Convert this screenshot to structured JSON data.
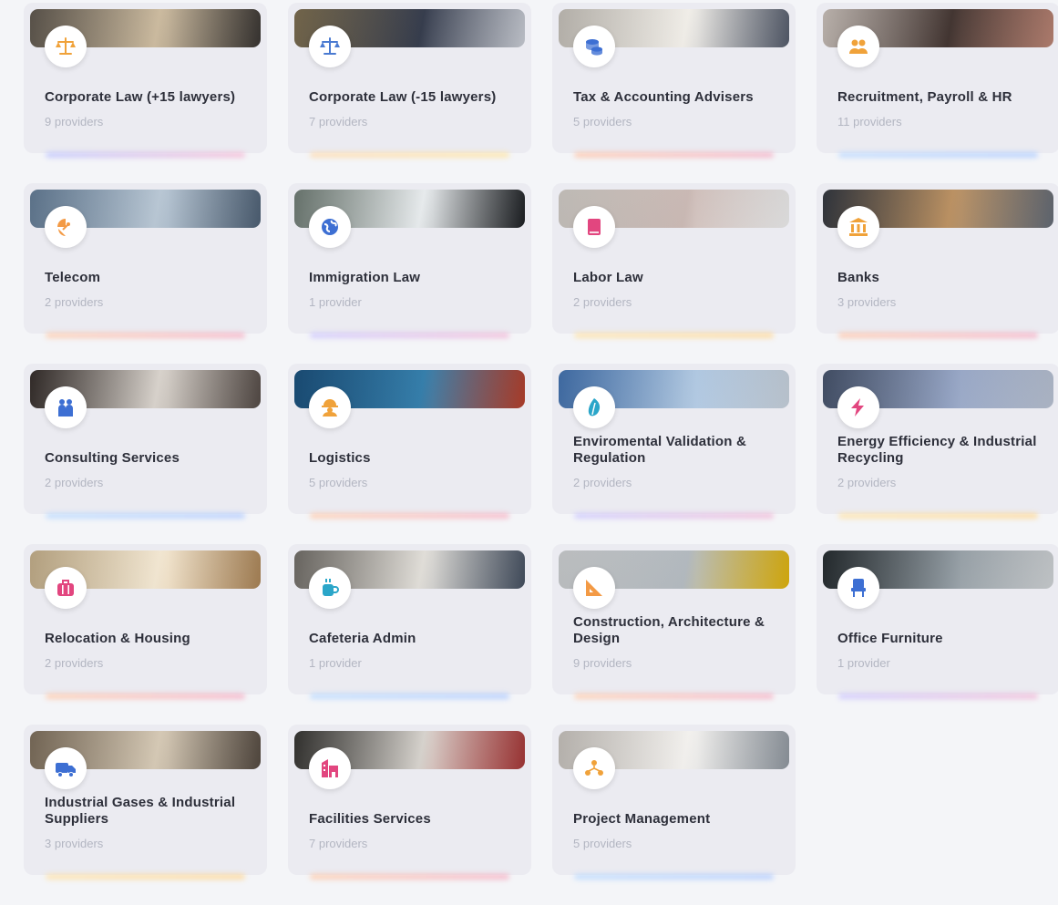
{
  "categories": [
    {
      "title": "Corporate Law (+15 lawyers)",
      "count": "9 providers",
      "icon": "scales-icon",
      "color": "#f0a23a",
      "banner": [
        "#6a6258",
        "#cbb99c",
        "#3e3a37"
      ],
      "glow": "linear-gradient(90deg,#b8c0ff,#f6b2d0)"
    },
    {
      "title": "Corporate Law (-15 lawyers)",
      "count": "7 providers",
      "icon": "scales-icon",
      "color": "#4a7ad1",
      "banner": [
        "#8a7a5a",
        "#2d3445",
        "#d9dde6"
      ],
      "glow": "linear-gradient(90deg,#ffd8a8,#ffe39b)"
    },
    {
      "title": "Tax & Accounting Advisers",
      "count": "5 providers",
      "icon": "coins-icon",
      "color": "#3d6fd3",
      "banner": [
        "#d9d4cc",
        "#f2efe9",
        "#5b6374"
      ],
      "glow": "linear-gradient(90deg,#ffc1a1,#f3a8c0)"
    },
    {
      "title": "Recruitment, Payroll & HR",
      "count": "11 providers",
      "icon": "people-icon",
      "color": "#f0a23a",
      "banner": [
        "#e0d6cf",
        "#3a2c28",
        "#c98f7e"
      ],
      "glow": "linear-gradient(90deg,#b6d6ff,#a9c8ff)"
    },
    {
      "title": "Telecom",
      "count": "2 providers",
      "icon": "satellite-icon",
      "color": "#f39a45",
      "banner": [
        "#6f8aa6",
        "#b7c6d4",
        "#54687e"
      ],
      "glow": "linear-gradient(90deg,#ffc8a4,#f6a7bd)"
    },
    {
      "title": "Immigration Law",
      "count": "1 provider",
      "icon": "globe-icon",
      "color": "#3d6fd3",
      "banner": [
        "#7c8a82",
        "#e8ecee",
        "#1f2226"
      ],
      "glow": "linear-gradient(90deg,#c9c2ff,#f2b0d2)"
    },
    {
      "title": "Labor Law",
      "count": "2 providers",
      "icon": "book-icon",
      "color": "#e2467f",
      "banner": [
        "#e7e2dc",
        "#c9b7b2",
        "#ffffff"
      ],
      "glow": "linear-gradient(90deg,#ffe0a0,#ffd48c)"
    },
    {
      "title": "Banks",
      "count": "3 providers",
      "icon": "bank-icon",
      "color": "#f0a23a",
      "banner": [
        "#3a3f48",
        "#b98d5c",
        "#6c7480"
      ],
      "glow": "linear-gradient(90deg,#ffc1a1,#f5a7bf)"
    },
    {
      "title": "Consulting Services",
      "count": "2 providers",
      "icon": "users-icon",
      "color": "#3d6fd3",
      "banner": [
        "#3b3330",
        "#d8d2cb",
        "#5b514c"
      ],
      "glow": "linear-gradient(90deg,#b5d8ff,#a9c6ff)"
    },
    {
      "title": "Logistics",
      "count": "5 providers",
      "icon": "worker-icon",
      "color": "#f0a23a",
      "banner": [
        "#1f5a8a",
        "#2c79a8",
        "#c4452f"
      ],
      "glow": "linear-gradient(90deg,#ffc7a4,#f7aabf)"
    },
    {
      "title": "Enviromental Validation & Regulation",
      "count": "2 providers",
      "icon": "leaf-icon",
      "color": "#2ba6c9",
      "banner": [
        "#4b7fc2",
        "#a8c2de",
        "#d7e2ee"
      ],
      "glow": "linear-gradient(90deg,#c6c2ff,#f1b0d2)"
    },
    {
      "title": "Energy Efficiency & Industrial Recycling",
      "count": "2 providers",
      "icon": "bolt-icon",
      "color": "#e2467f",
      "banner": [
        "#4f5d78",
        "#8f9fc0",
        "#c7d1e3"
      ],
      "glow": "linear-gradient(90deg,#ffe19f,#ffd58a)"
    },
    {
      "title": "Relocation & Housing",
      "count": "2 providers",
      "icon": "luggage-icon",
      "color": "#e2467f",
      "banner": [
        "#d9c29a",
        "#f3e7d1",
        "#b88f5e"
      ],
      "glow": "linear-gradient(90deg,#ffc5a2,#f5a6bf)"
    },
    {
      "title": "Cafeteria Admin",
      "count": "1 provider",
      "icon": "cup-icon",
      "color": "#2ba6c9",
      "banner": [
        "#7e7a74",
        "#e1ded8",
        "#4a5668"
      ],
      "glow": "linear-gradient(90deg,#b4d7ff,#a8c6ff)"
    },
    {
      "title": "Construction, Architecture & Design",
      "count": "9 providers",
      "icon": "ruler-icon",
      "color": "#f39a45",
      "banner": [
        "#e3e6e8",
        "#b0b7bd",
        "#f2c20f"
      ],
      "glow": "linear-gradient(90deg,#ffc7a4,#f6a8be)"
    },
    {
      "title": "Office Furniture",
      "count": "1 provider",
      "icon": "chair-icon",
      "color": "#3d6fd3",
      "banner": [
        "#2b3236",
        "#8a949b",
        "#dfe3e6"
      ],
      "glow": "linear-gradient(90deg,#c7c1ff,#f0b0d2)"
    },
    {
      "title": "Industrial Gases & Industrial Suppliers",
      "count": "3 providers",
      "icon": "truck-icon",
      "color": "#3d6fd3",
      "banner": [
        "#8a7a66",
        "#d5c8b3",
        "#5b5046"
      ],
      "glow": "linear-gradient(90deg,#ffe0a0,#ffd38a)"
    },
    {
      "title": "Facilities Services",
      "count": "7 providers",
      "icon": "building-icon",
      "color": "#e2467f",
      "banner": [
        "#3c3b38",
        "#d6d2cc",
        "#b23b3b"
      ],
      "glow": "linear-gradient(90deg,#ffc6a2,#f6a8be)"
    },
    {
      "title": "Project Management",
      "count": "5 providers",
      "icon": "nodes-icon",
      "color": "#f0a23a",
      "banner": [
        "#dbd6d0",
        "#f4f2ef",
        "#9ba3ac"
      ],
      "glow": "linear-gradient(90deg,#b5d7ff,#a8c6ff)"
    }
  ]
}
